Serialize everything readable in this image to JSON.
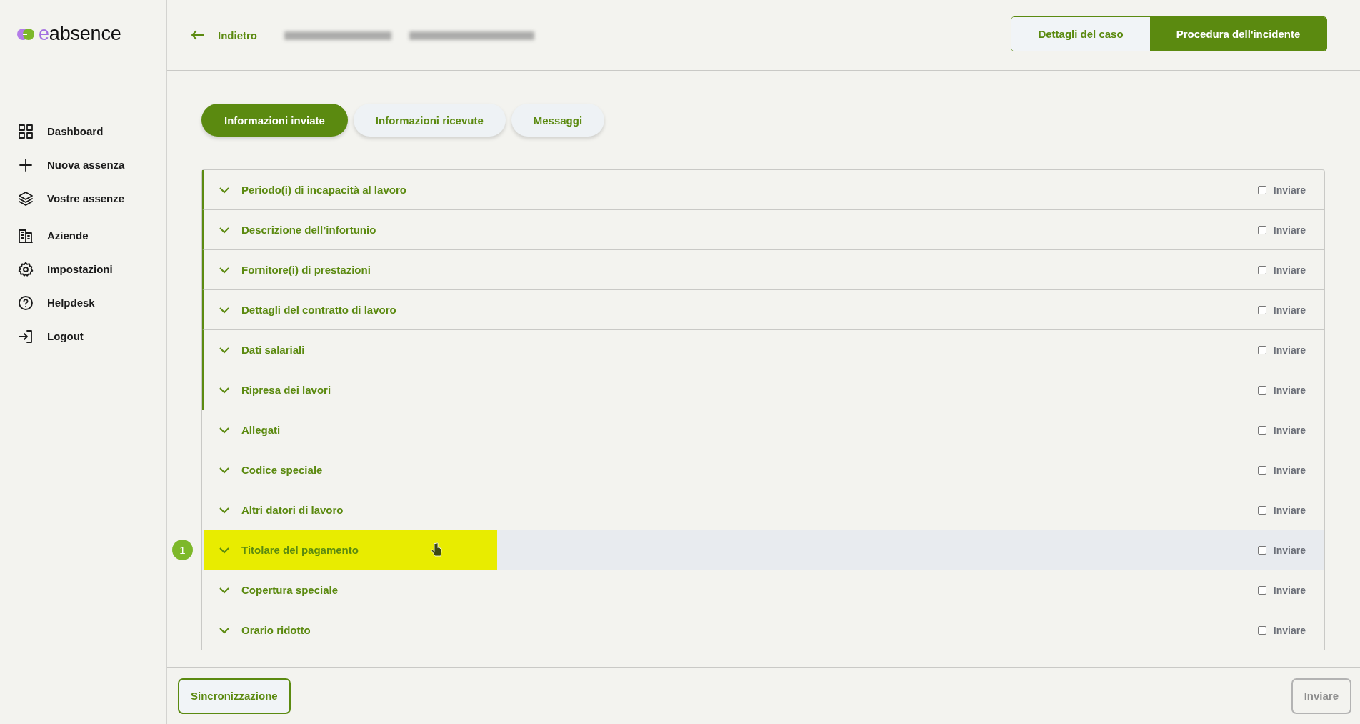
{
  "brand": {
    "name": "eabsence"
  },
  "sidebar": {
    "groups": [
      [
        {
          "label": "Dashboard"
        },
        {
          "label": "Nuova assenza"
        },
        {
          "label": "Vostre assenze"
        }
      ],
      [
        {
          "label": "Aziende"
        },
        {
          "label": "Impostazioni"
        },
        {
          "label": "Helpdesk"
        },
        {
          "label": "Logout"
        }
      ]
    ]
  },
  "header": {
    "back": "Indietro",
    "view_switch": [
      {
        "label": "Dettagli del caso",
        "selected": false
      },
      {
        "label": "Procedura dell'incidente",
        "selected": true
      }
    ]
  },
  "tabs": [
    {
      "label": "Informazioni inviate",
      "selected": true
    },
    {
      "label": "Informazioni ricevute",
      "selected": false
    },
    {
      "label": "Messaggi",
      "selected": false
    }
  ],
  "sections": [
    {
      "title": "Periodo(i) di incapacità al lavoro",
      "completed": true,
      "checkbox": "Inviare",
      "checked": false,
      "hovered": false
    },
    {
      "title": "Descrizione dell’infortunio",
      "completed": true,
      "checkbox": "Inviare",
      "checked": false,
      "hovered": false
    },
    {
      "title": "Fornitore(i) di prestazioni",
      "completed": true,
      "checkbox": "Inviare",
      "checked": false,
      "hovered": false
    },
    {
      "title": "Dettagli del contratto di lavoro",
      "completed": true,
      "checkbox": "Inviare",
      "checked": false,
      "hovered": false
    },
    {
      "title": "Dati salariali",
      "completed": true,
      "checkbox": "Inviare",
      "checked": false,
      "hovered": false
    },
    {
      "title": "Ripresa dei lavori",
      "completed": true,
      "checkbox": "Inviare",
      "checked": false,
      "hovered": false
    },
    {
      "title": "Allegati",
      "completed": false,
      "checkbox": "Inviare",
      "checked": false,
      "hovered": false
    },
    {
      "title": "Codice speciale",
      "completed": false,
      "checkbox": "Inviare",
      "checked": false,
      "hovered": false
    },
    {
      "title": "Altri datori di lavoro",
      "completed": false,
      "checkbox": "Inviare",
      "checked": false,
      "hovered": false
    },
    {
      "title": "Titolare del pagamento",
      "completed": false,
      "checkbox": "Inviare",
      "checked": false,
      "hovered": true,
      "highlighted": true,
      "badge": "1"
    },
    {
      "title": "Copertura speciale",
      "completed": false,
      "checkbox": "Inviare",
      "checked": false,
      "hovered": false
    },
    {
      "title": "Orario ridotto",
      "completed": false,
      "checkbox": "Inviare",
      "checked": false,
      "hovered": false
    }
  ],
  "footer": {
    "sync": "Sincronizzazione",
    "send": {
      "label": "Inviare",
      "disabled": true
    }
  }
}
